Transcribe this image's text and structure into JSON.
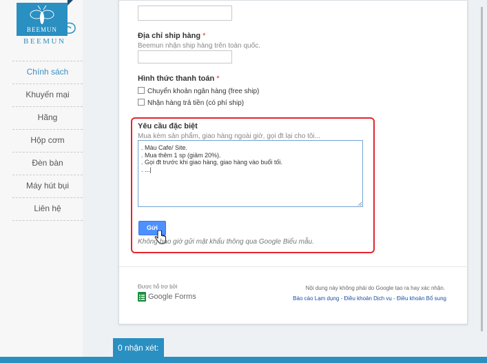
{
  "logo": {
    "small_text": "BEEMUN",
    "big_text": "BEEMUN"
  },
  "sidebar": {
    "items": [
      {
        "label": "Chính sách",
        "active": true
      },
      {
        "label": "Khuyến mại",
        "active": false
      },
      {
        "label": "Hãng",
        "active": false
      },
      {
        "label": "Hộp cơm",
        "active": false
      },
      {
        "label": "Đèn bàn",
        "active": false
      },
      {
        "label": "Máy hút bụi",
        "active": false
      },
      {
        "label": "Liên hệ",
        "active": false
      }
    ]
  },
  "form": {
    "shipping_address": {
      "label": "Địa chỉ ship hàng",
      "required_mark": "*",
      "help": "Beemun nhận ship hàng trên toàn quốc."
    },
    "payment": {
      "label": "Hình thức thanh toán",
      "required_mark": "*",
      "options": [
        {
          "label": "Chuyển khoản ngân hàng (free ship)",
          "checked": false
        },
        {
          "label": "Nhận hàng trả tiền (có phí ship)",
          "checked": false
        }
      ]
    },
    "special_request": {
      "label": "Yêu cầu đặc biệt",
      "help": "Mua kèm sản phẩm, giao hàng ngoài giờ, gọi đt lại cho tôi...",
      "lines": [
        ". Màu Cafe/ Site.",
        ". Mua thêm 1 sp (giảm 20%).",
        ". Gọi đt trước khi giao hàng, giao hàng vào buổi tối.",
        ". ...|"
      ]
    },
    "submit_label": "Gửi",
    "password_note": "Không bao giờ gửi mật khẩu thông qua Google Biểu mẫu."
  },
  "footer": {
    "powered_by": "Được hỗ trợ bởi",
    "brand": "Google Forms",
    "disclaimer": "Nội dung này không phải do Google tạo ra hay xác nhận.",
    "links": [
      "Báo cáo Lạm dụng",
      "Điều khoản Dịch vụ",
      "Điều khoản Bổ sung"
    ],
    "link_separator": " - "
  },
  "comments": {
    "label": "0 nhận xét:"
  },
  "colors": {
    "accent": "#2a8fc1",
    "highlight": "#e3242b",
    "button": "#4d90fe",
    "link": "#1a4ea3"
  }
}
